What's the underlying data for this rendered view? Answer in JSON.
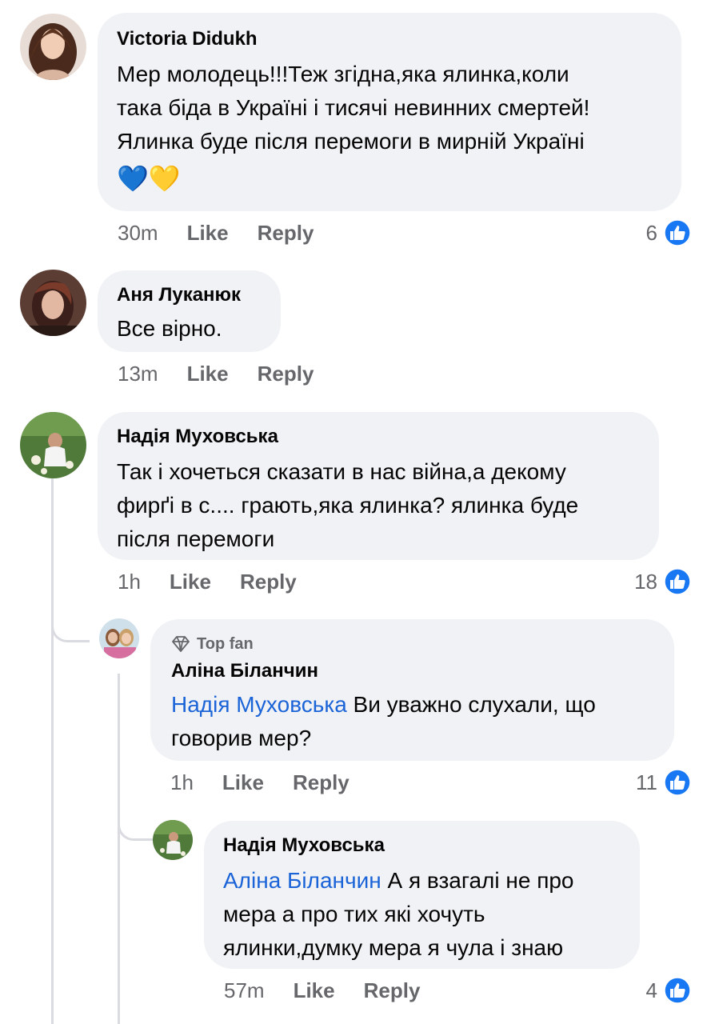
{
  "colors": {
    "bubble": "#f0f2f5",
    "mention": "#1b64d8",
    "like_blue": "#1877f2",
    "meta": "#65676b"
  },
  "comments": [
    {
      "author": "Victoria  Didukh",
      "lines": [
        "Мер молодець!!!Теж згідна,яка ялинка,коли",
        "така біда в Україні і тисячі невинних смертей!",
        "Ялинка буде після перемоги в мирній Україні"
      ],
      "emoji": "💙💛",
      "time": "30m",
      "like_label": "Like",
      "reply_label": "Reply",
      "like_count": "6"
    },
    {
      "author": "Аня Луканюк",
      "lines": [
        "Все вірно."
      ],
      "time": "13m",
      "like_label": "Like",
      "reply_label": "Reply"
    },
    {
      "author": "Надія Муховська",
      "lines": [
        "Так і хочеться сказати в нас війна,а декому",
        "фирґі в с.... грають,яка ялинка? ялинка буде",
        "після перемоги"
      ],
      "time": "1h",
      "like_label": "Like",
      "reply_label": "Reply",
      "like_count": "18"
    },
    {
      "badge": "Top fan",
      "author": "Аліна Біланчин",
      "mention": "Надія Муховська",
      "lines": [
        " Ви уважно слухали, що",
        "говорив мер?"
      ],
      "time": "1h",
      "like_label": "Like",
      "reply_label": "Reply",
      "like_count": "11"
    },
    {
      "author": "Надія Муховська",
      "mention": "Аліна Біланчин",
      "lines": [
        " А я взагалі не про",
        "мера а про тих які хочуть",
        "ялинки,думку мера я чула і знаю"
      ],
      "time": "57m",
      "like_label": "Like",
      "reply_label": "Reply",
      "like_count": "4"
    }
  ]
}
